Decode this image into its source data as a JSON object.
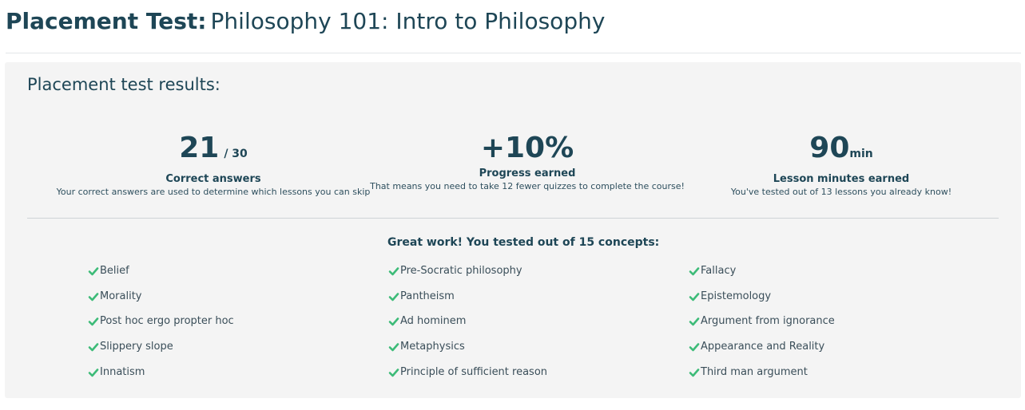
{
  "header": {
    "prefix": "Placement Test:",
    "course": "Philosophy 101: Intro to Philosophy"
  },
  "results": {
    "title": "Placement test results:",
    "stats": [
      {
        "value": "21",
        "suffix": "/ 30",
        "label": "Correct answers",
        "description": "Your correct answers are used to determine which lessons you can skip"
      },
      {
        "value": "+10%",
        "suffix": "",
        "label": "Progress earned",
        "description": "That means you need to take 12 fewer quizzes to complete the course!"
      },
      {
        "value": "90",
        "suffix": "min",
        "label": "Lesson minutes earned",
        "description": "You've tested out of 13 lessons you already know!"
      }
    ],
    "concepts_title": "Great work! You tested out of 15 concepts:",
    "concepts": [
      [
        "Belief",
        "Morality",
        "Post hoc ergo propter hoc",
        "Slippery slope",
        "Innatism"
      ],
      [
        "Pre-Socratic philosophy",
        "Pantheism",
        "Ad hominem",
        "Metaphysics",
        "Principle of sufficient reason"
      ],
      [
        "Fallacy",
        "Epistemology",
        "Argument from ignorance",
        "Appearance and Reality",
        "Third man argument"
      ]
    ]
  },
  "icons": {
    "check": "checkmark-icon"
  },
  "colors": {
    "heading": "#1e4656",
    "panel_background": "#f4f4f4",
    "check": "#3dbb78"
  }
}
